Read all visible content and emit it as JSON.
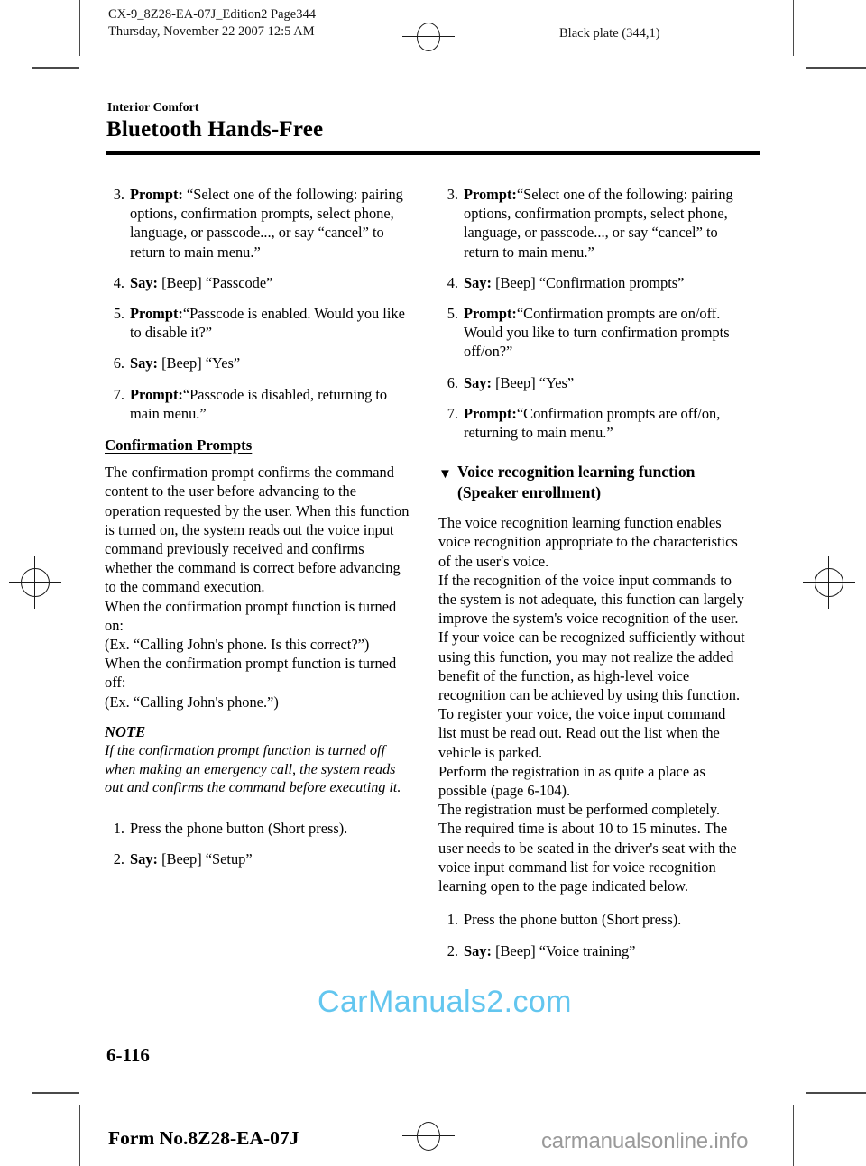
{
  "print_slug": {
    "line1": "CX-9_8Z28-EA-07J_Edition2 Page344",
    "line2": "Thursday, November 22 2007 12:5 AM",
    "plate": "Black plate (344,1)"
  },
  "running_head": {
    "section": "Interior Comfort",
    "title": "Bluetooth Hands-Free"
  },
  "left_column": {
    "steps_passcode": [
      {
        "num": "3.",
        "lead": "Prompt:",
        "lead_space": true,
        "text": "“Select one of the following: pairing options, confirmation prompts, select phone, language, or passcode..., or say “cancel” to return to main menu.”"
      },
      {
        "num": "4.",
        "lead": "Say:",
        "lead_space": true,
        "text": "[Beep] “Passcode”"
      },
      {
        "num": "5.",
        "lead": "Prompt:",
        "lead_space": false,
        "text": "“Passcode is enabled. Would you like to disable it?”"
      },
      {
        "num": "6.",
        "lead": "Say:",
        "lead_space": true,
        "text": "[Beep] “Yes”"
      },
      {
        "num": "7.",
        "lead": "Prompt:",
        "lead_space": false,
        "text": "“Passcode is disabled, returning to main menu.”"
      }
    ],
    "subhead": "Confirmation Prompts",
    "paragraphs": [
      "The confirmation prompt confirms the command content to the user before advancing to the operation requested by the user. When this function is turned on, the system reads out the voice input command previously received and confirms whether the command is correct before advancing to the command execution.",
      "When the confirmation prompt function is turned on:",
      "(Ex. “Calling John's phone. Is this correct?”)",
      "When the confirmation prompt function is turned off:",
      "(Ex. “Calling John's phone.”)"
    ],
    "note_label": "NOTE",
    "note_body": "If the confirmation prompt function is turned off when making an emergency call, the system reads out and confirms the command before executing it.",
    "steps_setup": [
      {
        "num": "1.",
        "lead": "",
        "lead_space": false,
        "text": "Press the phone button (Short press)."
      },
      {
        "num": "2.",
        "lead": "Say:",
        "lead_space": true,
        "text": "[Beep] “Setup”"
      }
    ]
  },
  "right_column": {
    "steps_confirmation": [
      {
        "num": "3.",
        "lead": "Prompt:",
        "lead_space": false,
        "text": "“Select one of the following: pairing options, confirmation prompts, select phone, language, or passcode..., or say “cancel” to return to main menu.”"
      },
      {
        "num": "4.",
        "lead": "Say:",
        "lead_space": true,
        "text": "[Beep] “Confirmation prompts”"
      },
      {
        "num": "5.",
        "lead": "Prompt:",
        "lead_space": false,
        "text": "“Confirmation prompts are on/off. Would you like to turn confirmation prompts off/on?”"
      },
      {
        "num": "6.",
        "lead": "Say:",
        "lead_space": true,
        "text": "[Beep] “Yes”"
      },
      {
        "num": "7.",
        "lead": "Prompt:",
        "lead_space": false,
        "text": "“Confirmation prompts are off/on, returning to main menu.”"
      }
    ],
    "section_marker": "▼",
    "section_heading": "Voice recognition learning function (Speaker enrollment)",
    "paragraphs": [
      "The voice recognition learning function enables voice recognition appropriate to the characteristics of the user's voice.",
      "If the recognition of the voice input commands to the system is not adequate, this function can largely improve the system's voice recognition of the user. If your voice can be recognized sufficiently without using this function, you may not realize the added benefit of the function, as high-level voice recognition can be achieved by using this function.",
      "To register your voice, the voice input command list must be read out. Read out the list when the vehicle is parked.",
      "Perform the registration in as quite a place as possible (page 6-104).",
      "The registration must be performed completely. The required time is about 10 to 15 minutes. The user needs to be seated in the driver's seat with the voice input command list for voice recognition learning open to the page indicated below."
    ],
    "steps_training": [
      {
        "num": "1.",
        "lead": "",
        "lead_space": false,
        "text": "Press the phone button (Short press)."
      },
      {
        "num": "2.",
        "lead": "Say:",
        "lead_space": true,
        "text": "[Beep] “Voice training”"
      }
    ]
  },
  "footer": {
    "folio": "6-116",
    "form_number": "Form No.8Z28-EA-07J"
  },
  "watermarks": {
    "primary": "CarManuals2.com",
    "secondary": "carmanualsonline.info",
    "primary_color": "#63c6ef",
    "secondary_color": "#9a9a9a"
  }
}
